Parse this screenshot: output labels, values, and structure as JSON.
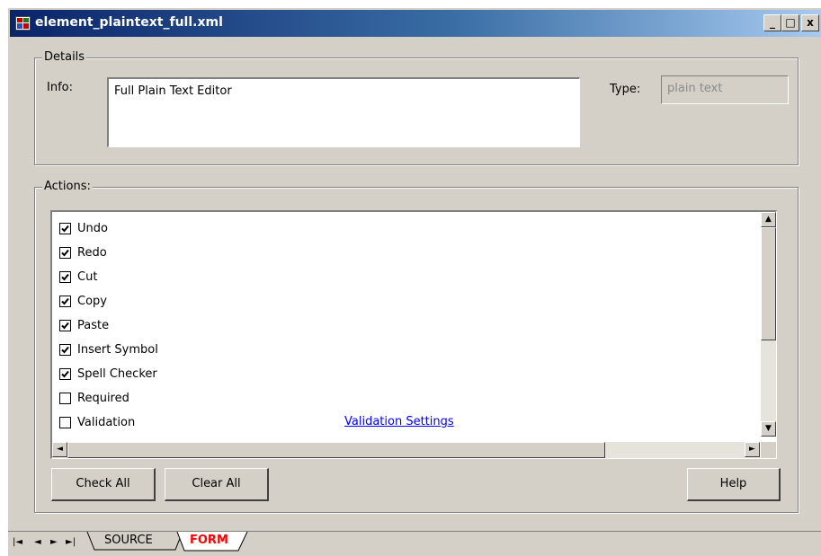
{
  "window": {
    "title": "element_plaintext_full.xml",
    "minimize_label": "_",
    "maximize_label": "□",
    "close_label": "x"
  },
  "details": {
    "legend": "Details",
    "info_label": "Info:",
    "info_value": "Full Plain Text Editor",
    "type_label": "Type:",
    "type_value": "plain text"
  },
  "actions": {
    "legend": "Actions:",
    "items": [
      {
        "label": "Undo",
        "checked": true
      },
      {
        "label": "Redo",
        "checked": true
      },
      {
        "label": "Cut",
        "checked": true
      },
      {
        "label": "Copy",
        "checked": true
      },
      {
        "label": "Paste",
        "checked": true
      },
      {
        "label": "Insert Symbol",
        "checked": true
      },
      {
        "label": "Spell Checker",
        "checked": true
      },
      {
        "label": "Required",
        "checked": false
      },
      {
        "label": "Validation",
        "checked": false
      }
    ],
    "validation_link": "Validation Settings",
    "scroll_up_icon": "▲",
    "scroll_down_icon": "▼",
    "scroll_left_icon": "◄",
    "scroll_right_icon": "►"
  },
  "buttons": {
    "check_all": "Check All",
    "clear_all": "Clear All",
    "help": "Help"
  },
  "tabs": {
    "nav_first": "|◄",
    "nav_prev": "◄",
    "nav_next": "►",
    "nav_last": "►|",
    "source": "SOURCE",
    "form": "FORM",
    "active_color": "#ff0000"
  }
}
